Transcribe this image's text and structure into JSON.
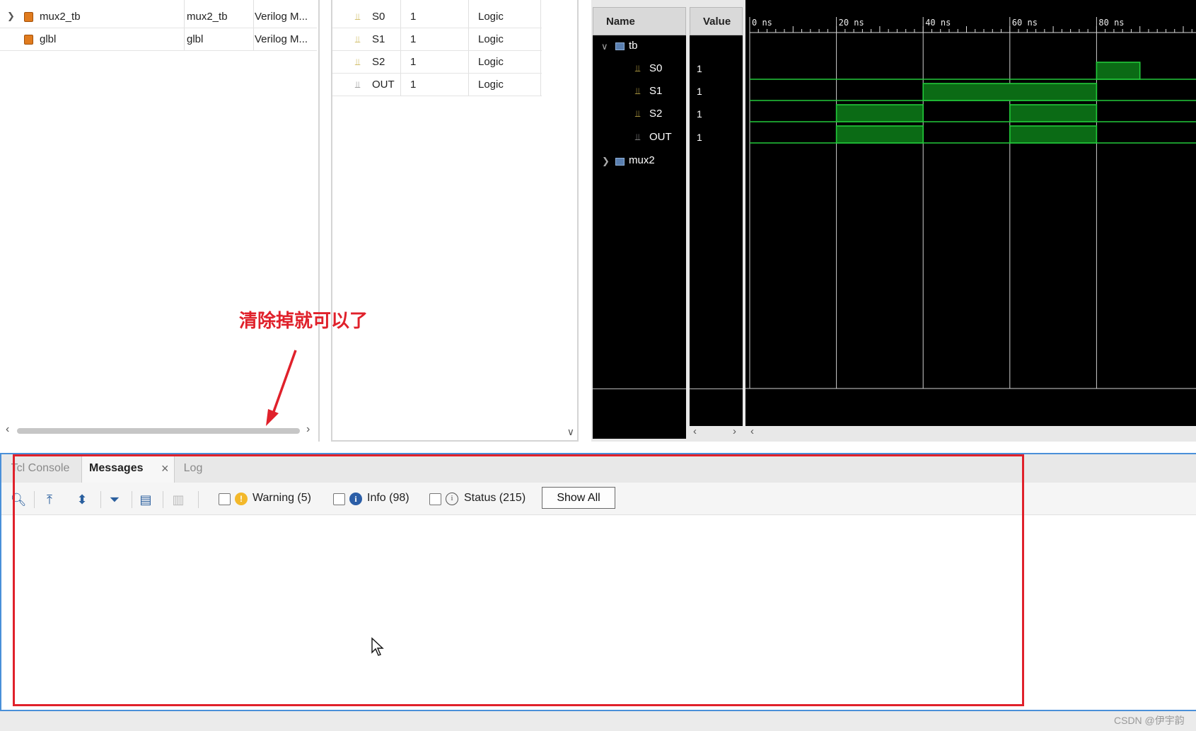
{
  "hierarchy": {
    "rows": [
      {
        "name": "mux2_tb",
        "col2": "mux2_tb",
        "col3": "Verilog M...",
        "expandable": true
      },
      {
        "name": "glbl",
        "col2": "glbl",
        "col3": "Verilog M...",
        "expandable": false
      }
    ]
  },
  "objects": {
    "rows": [
      {
        "name": "S0",
        "value": "1",
        "type": "Logic"
      },
      {
        "name": "S1",
        "value": "1",
        "type": "Logic"
      },
      {
        "name": "S2",
        "value": "1",
        "type": "Logic"
      },
      {
        "name": "OUT",
        "value": "1",
        "type": "Logic"
      }
    ]
  },
  "wave": {
    "name_header": "Name",
    "value_header": "Value",
    "tree": [
      {
        "label": "tb",
        "kind": "module",
        "expanded": true
      },
      {
        "label": "S0",
        "kind": "signal",
        "value": "1"
      },
      {
        "label": "S1",
        "kind": "signal",
        "value": "1"
      },
      {
        "label": "S2",
        "kind": "signal",
        "value": "1"
      },
      {
        "label": "OUT",
        "kind": "signal",
        "value": "1"
      },
      {
        "label": "mux2",
        "kind": "module",
        "expanded": false
      }
    ],
    "time_labels": [
      "0 ns",
      "20 ns",
      "40 ns",
      "60 ns",
      "80 ns"
    ],
    "signal_color": "#22c93a",
    "waveforms": [
      {
        "signal": "S0",
        "high": [
          [
            80,
            90
          ]
        ]
      },
      {
        "signal": "S1",
        "high": [
          [
            40,
            80
          ]
        ]
      },
      {
        "signal": "S2",
        "high": [
          [
            20,
            40
          ],
          [
            60,
            80
          ]
        ]
      },
      {
        "signal": "OUT",
        "high": [
          [
            20,
            40
          ],
          [
            60,
            80
          ]
        ]
      }
    ]
  },
  "messages": {
    "tabs": [
      {
        "label": "Tcl Console",
        "active": false
      },
      {
        "label": "Messages",
        "active": true
      },
      {
        "label": "Log",
        "active": false
      }
    ],
    "close_glyph": "×",
    "filters": {
      "warning": "Warning (5)",
      "info": "Info (98)",
      "status": "Status (215)"
    },
    "show_all": "Show All"
  },
  "annotation": {
    "text": "清除掉就可以了",
    "color": "#e0212b"
  },
  "watermark": "CSDN @伊宇韵"
}
